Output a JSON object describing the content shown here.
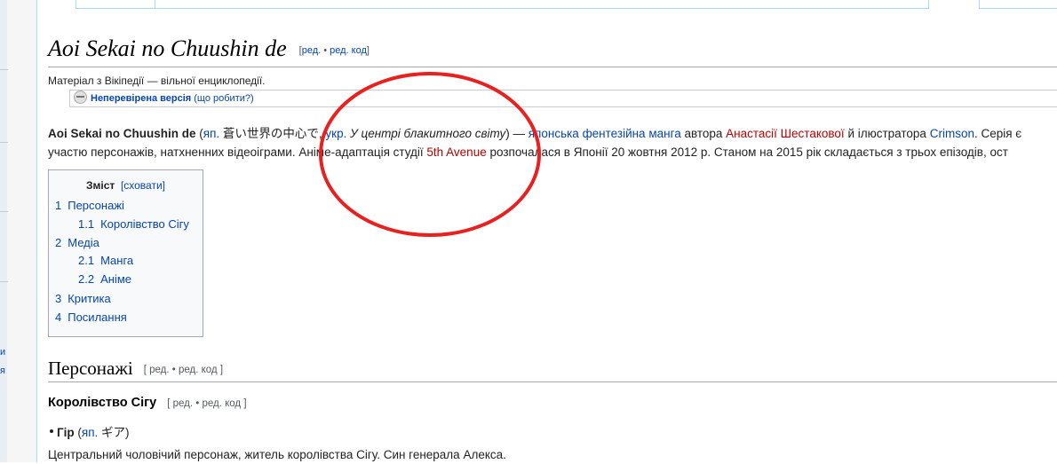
{
  "sidebar": {
    "fragments": [
      "и",
      "я"
    ]
  },
  "article": {
    "title": "Aoi Sekai no Chuushin de",
    "title_edit": {
      "open": "[",
      "edit": "ред.",
      "sep": "•",
      "source": "ред. код",
      "close": "]"
    },
    "site_sub": "Матеріал з Вікіпедії — вільної енциклопедії.",
    "flagged": {
      "label": "Неперевірена версія",
      "help": "(що робити?)"
    },
    "intro": {
      "line1": {
        "subject": "Aoi Sekai no Chuushin de",
        "p_open": " (",
        "lang_ja": "яп.",
        "ja_text": " 蒼い世界の中心で",
        "comma": ", ",
        "lang_uk": "укр.",
        "uk_text": " У центрі блакитного світу",
        "p_close": ") — ",
        "genre": "японська фентезійна манга",
        "by": " автора ",
        "author": "Анастасії Шестакової",
        "and_ill": " й ілюстратора ",
        "illustrator": "Crimson",
        "tail": ". Серія є"
      },
      "line2": {
        "t1": "участю персонажів, натхненних відеоіграми. Аніме-адаптація студії ",
        "studio": "5th Avenue",
        "t2": " розпочалася в Японії 20 жовтня 2012 р. Станом на 2015 рік складається з трьох епізодів, ост"
      }
    },
    "toc": {
      "title": "Зміст",
      "toggle": "[сховати]",
      "items": [
        {
          "num": "1",
          "label": "Персонажі"
        },
        {
          "num": "1.1",
          "label": "Королівство Сігу"
        },
        {
          "num": "2",
          "label": "Медіа"
        },
        {
          "num": "2.1",
          "label": "Манга"
        },
        {
          "num": "2.2",
          "label": "Аніме"
        },
        {
          "num": "3",
          "label": "Критика"
        },
        {
          "num": "4",
          "label": "Посилання"
        }
      ]
    },
    "section1": {
      "heading": "Персонажі",
      "edit": "[ ред. • ред. код ]"
    },
    "subsection1": {
      "heading": "Королівство Сігу",
      "edit": "[ ред. • ред. код ]"
    },
    "bullet1": {
      "name": "Гір",
      "p_open": " (",
      "lang_ja": "яп.",
      "ja_text": " ギア",
      "p_close": ")"
    },
    "para1": "Центральний чоловічий персонаж, житель королівства Сігу. Син генерала Алекса."
  },
  "colors": {
    "link": "#0645ad",
    "redlink": "#ba0000",
    "annotation": "#e8201f",
    "rule": "#a2a9b1"
  }
}
